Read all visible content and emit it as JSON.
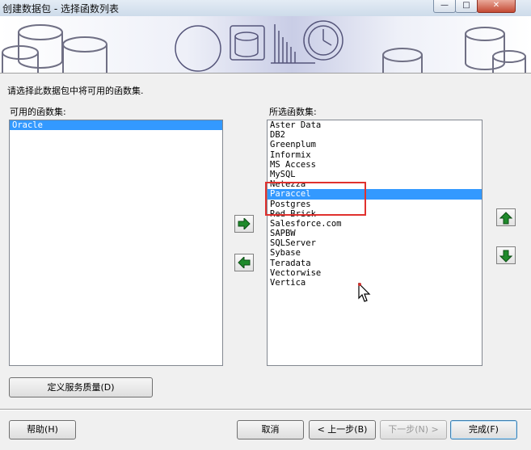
{
  "window": {
    "title": "创建数据包 - 选择函数列表",
    "minimize_glyph": "—",
    "maximize_glyph": "□",
    "close_glyph": "✕"
  },
  "instruction": "请选择此数据包中将可用的函数集.",
  "available": {
    "label": "可用的函数集:",
    "items": [
      "Oracle"
    ],
    "selected_index": 0
  },
  "selected": {
    "label": "所选函数集:",
    "items": [
      "Aster Data",
      "DB2",
      "Greenplum",
      "Informix",
      "MS Access",
      "MySQL",
      "Netezza",
      "Paraccel",
      "Postgres",
      "Red Brick",
      "Salesforce.com",
      "SAPBW",
      "SQLServer",
      "Sybase",
      "Teradata",
      "Vectorwise",
      "Vertica"
    ],
    "selected_index": 7
  },
  "buttons": {
    "define_qos": "定义服务质量(D)",
    "help": "帮助(H)",
    "cancel": "取消",
    "back": "< 上一步(B)",
    "next": "下一步(N) >",
    "finish": "完成(F)"
  },
  "icons": {
    "add": "arrow-right-icon",
    "remove": "arrow-left-icon",
    "move_up": "arrow-up-icon",
    "move_down": "arrow-down-icon"
  },
  "colors": {
    "selection": "#3399ff",
    "arrow_green": "#1f8a2b",
    "highlight_red": "#e0312e"
  }
}
